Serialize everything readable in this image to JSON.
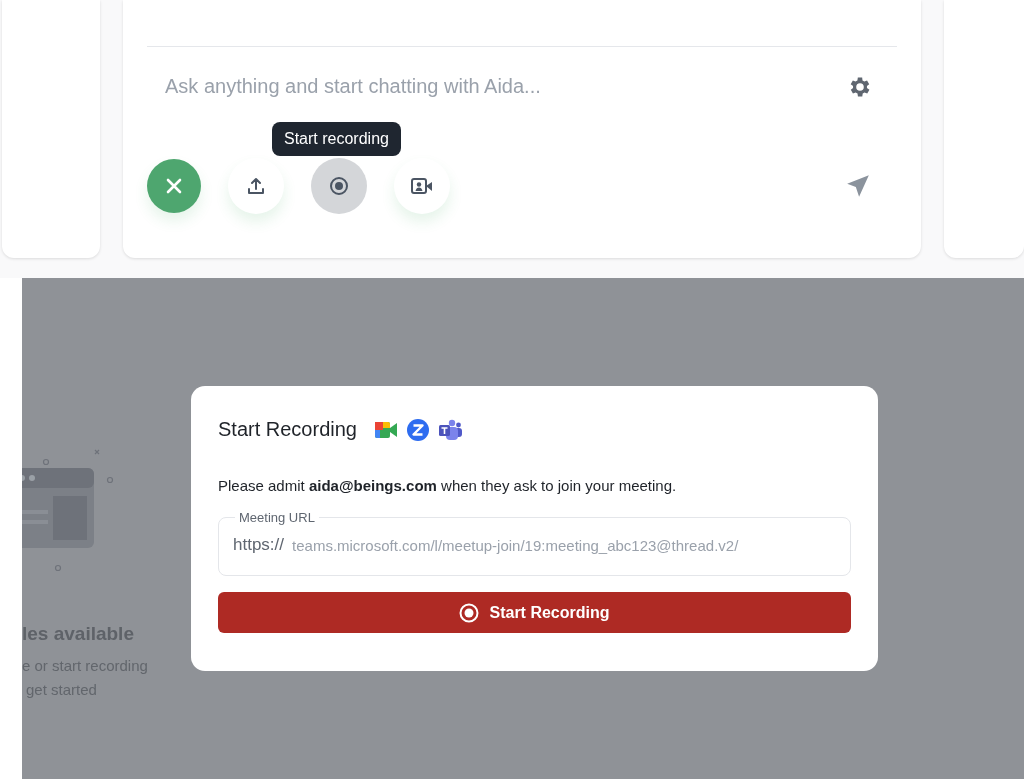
{
  "composer": {
    "placeholder": "Ask anything and start chatting with Aida...",
    "tooltip": "Start recording",
    "actions": [
      {
        "kind": "close",
        "selected": false
      },
      {
        "kind": "upload",
        "selected": false
      },
      {
        "kind": "record",
        "selected": true
      },
      {
        "kind": "video",
        "selected": false
      }
    ]
  },
  "empty_state": {
    "title": "les available",
    "lines": [
      "e or start recording",
      "get started"
    ]
  },
  "modal": {
    "title": "Start Recording",
    "message": "Please admit **aida@beings.com** when they ask to join your meeting.",
    "field": {
      "label": "Meeting URL",
      "prefix": "https://",
      "placeholder": "teams.microsoft.com/l/meetup-join/19:meeting_abc123@thread.v2/"
    },
    "button": "Start Recording"
  }
}
